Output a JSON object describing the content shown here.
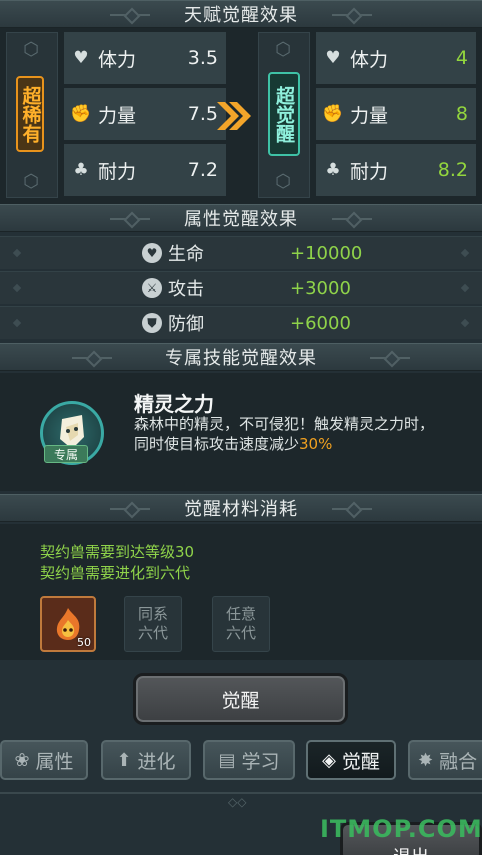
{
  "sections": {
    "talent_title": "天赋觉醒效果",
    "attr_title": "属性觉醒效果",
    "skill_title": "专属技能觉醒效果",
    "material_title": "觉醒材料消耗"
  },
  "talent": {
    "before_rank": "超稀有",
    "after_rank": "超觉醒",
    "before": [
      {
        "icon": "heart-icon",
        "label": "体力",
        "value": "3.5"
      },
      {
        "icon": "fist-icon",
        "label": "力量",
        "value": "7.5"
      },
      {
        "icon": "figure-icon",
        "label": "耐力",
        "value": "7.2"
      }
    ],
    "after": [
      {
        "icon": "heart-icon",
        "label": "体力",
        "value": "4"
      },
      {
        "icon": "fist-icon",
        "label": "力量",
        "value": "8"
      },
      {
        "icon": "figure-icon",
        "label": "耐力",
        "value": "8.2"
      }
    ]
  },
  "attributes": [
    {
      "icon": "hp-icon",
      "label": "生命",
      "value": "+10000"
    },
    {
      "icon": "sword-icon",
      "label": "攻击",
      "value": "+3000"
    },
    {
      "icon": "shield-icon",
      "label": "防御",
      "value": "+6000"
    }
  ],
  "skill": {
    "badge": "专属",
    "name": "精灵之力",
    "desc_line1": "森林中的精灵，不可侵犯！触发精灵之力时，",
    "desc_line2": "同时使目标攻击速度减少",
    "desc_highlight": "30%"
  },
  "materials": {
    "req1": "契约兽需要到达等级30",
    "req2": "契约兽需要进化到六代",
    "item_count": "50",
    "slot2_line1": "同系",
    "slot2_line2": "六代",
    "slot3_line1": "任意",
    "slot3_line2": "六代"
  },
  "awaken_button": "觉醒",
  "tabs": [
    {
      "icon": "paw-icon",
      "label": "属性"
    },
    {
      "icon": "arrow-up-icon",
      "label": "进化"
    },
    {
      "icon": "book-icon",
      "label": "学习"
    },
    {
      "icon": "mask-icon",
      "label": "觉醒"
    },
    {
      "icon": "beast-icon",
      "label": "融合"
    }
  ],
  "exit_button": "退出",
  "watermark": "ITMOP.COM",
  "colors": {
    "accent_green": "#8fd34a",
    "rare_orange": "#e8931c",
    "awaken_teal": "#3fc2a6",
    "highlight_orange": "#f0a020"
  }
}
